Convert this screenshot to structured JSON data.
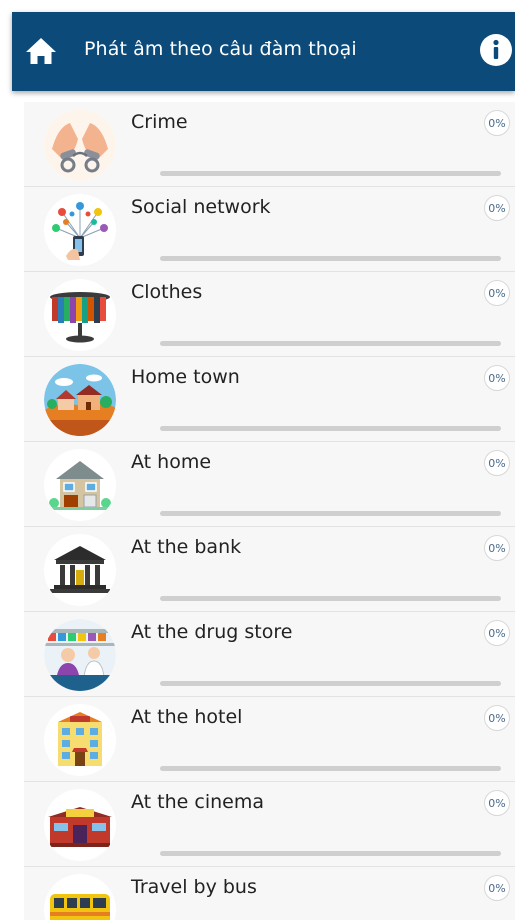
{
  "header": {
    "title": "Phát âm theo câu đàm thoại",
    "home_icon": "home-icon",
    "info_icon": "info-icon",
    "color": "#0c4a79"
  },
  "topics": [
    {
      "label": "Crime",
      "progress": "0%",
      "progress_value": 0,
      "icon": "handcuffs-icon"
    },
    {
      "label": "Social network",
      "progress": "0%",
      "progress_value": 0,
      "icon": "social-network-icon"
    },
    {
      "label": "Clothes",
      "progress": "0%",
      "progress_value": 0,
      "icon": "clothes-rack-icon"
    },
    {
      "label": "Home town",
      "progress": "0%",
      "progress_value": 0,
      "icon": "home-town-icon"
    },
    {
      "label": "At home",
      "progress": "0%",
      "progress_value": 0,
      "icon": "house-icon"
    },
    {
      "label": "At the bank",
      "progress": "0%",
      "progress_value": 0,
      "icon": "bank-icon"
    },
    {
      "label": "At the drug store",
      "progress": "0%",
      "progress_value": 0,
      "icon": "pharmacy-icon"
    },
    {
      "label": "At the hotel",
      "progress": "0%",
      "progress_value": 0,
      "icon": "hotel-icon"
    },
    {
      "label": "At the cinema",
      "progress": "0%",
      "progress_value": 0,
      "icon": "cinema-icon"
    },
    {
      "label": "Travel by bus",
      "progress": "0%",
      "progress_value": 0,
      "icon": "bus-icon"
    }
  ]
}
